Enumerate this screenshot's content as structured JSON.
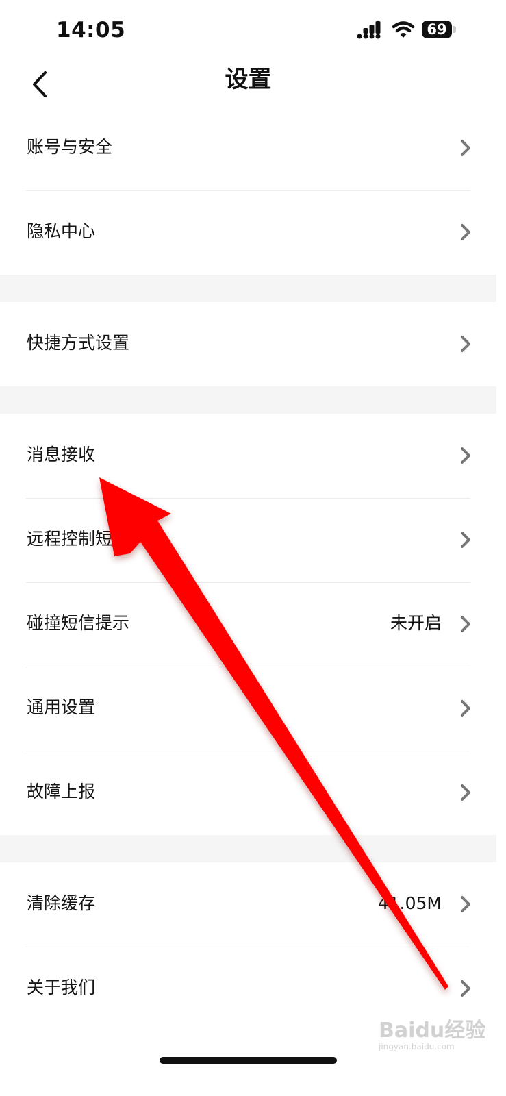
{
  "status_bar": {
    "time": "14:05",
    "battery_level": "69",
    "icons": [
      "signal-icon",
      "wifi-icon",
      "battery-icon"
    ]
  },
  "header": {
    "title": "设置",
    "back_icon": "chevron-left-icon"
  },
  "settings": {
    "groups": [
      [
        {
          "label": "账号与安全",
          "value": ""
        },
        {
          "label": "隐私中心",
          "value": ""
        }
      ],
      [
        {
          "label": "快捷方式设置",
          "value": ""
        }
      ],
      [
        {
          "label": "消息接收",
          "value": ""
        },
        {
          "label": "远程控制短",
          "value": ""
        },
        {
          "label": "碰撞短信提示",
          "value": "未开启"
        },
        {
          "label": "通用设置",
          "value": ""
        },
        {
          "label": "故障上报",
          "value": ""
        }
      ],
      [
        {
          "label": "清除缓存",
          "value": "41.05M"
        },
        {
          "label": "关于我们",
          "value": ""
        }
      ]
    ]
  },
  "watermark": {
    "text": "Baidu经验",
    "url": "jingyan.baidu.com"
  },
  "colors": {
    "annotation_arrow": "#ff0000",
    "background": "#ffffff",
    "section_gap": "#f5f5f5",
    "divider": "#ececec"
  }
}
